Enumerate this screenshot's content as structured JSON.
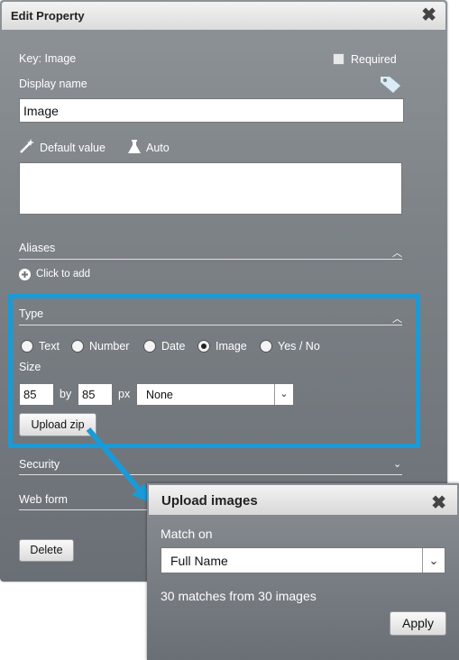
{
  "dialog": {
    "title": "Edit Property",
    "key_label": "Key: Image",
    "required_label": "Required",
    "display_name_label": "Display name",
    "display_name_value": "Image",
    "default_value_label": "Default value",
    "auto_label": "Auto",
    "default_value_text": "",
    "aliases": {
      "heading": "Aliases",
      "add_label": "Click to add"
    },
    "type": {
      "heading": "Type",
      "options": [
        "Text",
        "Number",
        "Date",
        "Image",
        "Yes / No"
      ],
      "selected": "Image",
      "size_label": "Size",
      "width": "85",
      "by_label": "by",
      "height": "85",
      "unit_label": "px",
      "scale_select": "None",
      "upload_button": "Upload zip"
    },
    "security_heading": "Security",
    "web_form_heading": "Web form",
    "delete_button": "Delete"
  },
  "popup": {
    "title": "Upload images",
    "match_on_label": "Match on",
    "match_on_value": "Full Name",
    "status": "30 matches from 30 images",
    "apply_button": "Apply"
  },
  "colors": {
    "highlight": "#1a9ad6",
    "panel": "#7d8287"
  },
  "icons": [
    "close-icon",
    "tag-icon",
    "magic-wand-icon",
    "flask-icon",
    "plus-circle-icon",
    "chevron-down-icon",
    "chevron-up-icon"
  ]
}
